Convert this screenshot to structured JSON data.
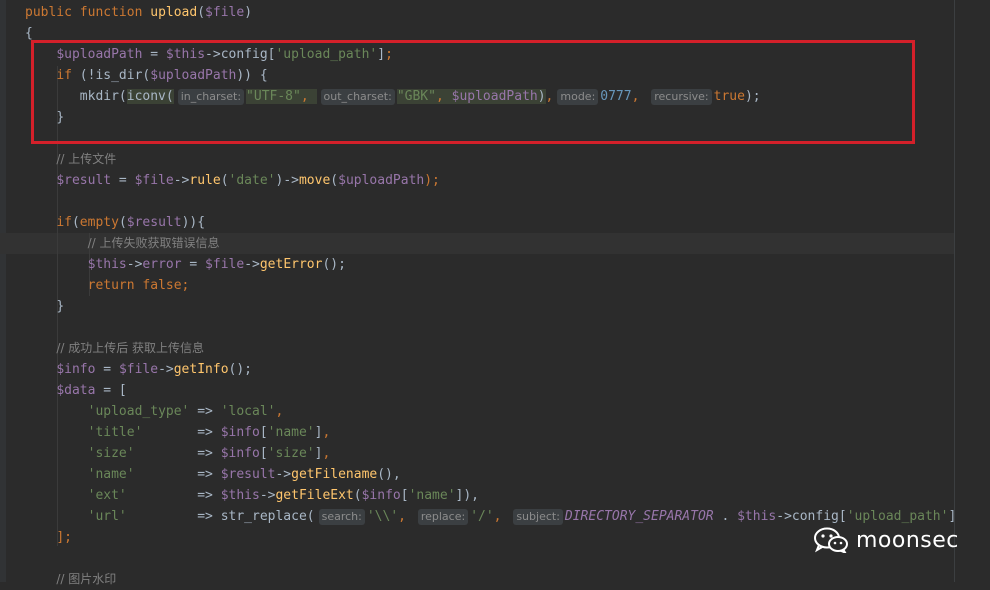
{
  "code_lines": [
    [
      {
        "t": "public ",
        "c": "kw"
      },
      {
        "t": "function ",
        "c": "kw"
      },
      {
        "t": "upload",
        "c": "fn"
      },
      {
        "t": "(",
        "c": "plain"
      },
      {
        "t": "$file",
        "c": "var"
      },
      {
        "t": ")",
        "c": "plain"
      }
    ],
    [
      {
        "t": "{",
        "c": "plain"
      }
    ],
    [
      {
        "t": "    "
      },
      {
        "t": "$uploadPath",
        "c": "var"
      },
      {
        "t": " = ",
        "c": "plain"
      },
      {
        "t": "$this",
        "c": "var"
      },
      {
        "t": "->",
        "c": "plain"
      },
      {
        "t": "config",
        "c": "plain"
      },
      {
        "t": "[",
        "c": "plain"
      },
      {
        "t": "'upload_path'",
        "c": "str"
      },
      {
        "t": "]",
        "c": "plain"
      },
      {
        "t": ";",
        "c": "kw"
      }
    ],
    [
      {
        "t": "    "
      },
      {
        "t": "if ",
        "c": "kw"
      },
      {
        "t": "(!",
        "c": "plain"
      },
      {
        "t": "is_dir",
        "c": "plain"
      },
      {
        "t": "(",
        "c": "plain"
      },
      {
        "t": "$uploadPath",
        "c": "var"
      },
      {
        "t": ")) {",
        "c": "plain"
      }
    ],
    [
      {
        "t": "       mkdir(",
        "c": "plain"
      },
      {
        "t": "iconv(",
        "c": "plain",
        "sel": true
      },
      {
        "h": "in_charset:"
      },
      {
        "t": "\"UTF-8\"",
        "c": "str",
        "sel": true
      },
      {
        "t": ", ",
        "c": "kw",
        "sel": true
      },
      {
        "h": "out_charset:"
      },
      {
        "t": "\"GBK\"",
        "c": "str",
        "sel": true
      },
      {
        "t": ", ",
        "c": "kw",
        "sel": true
      },
      {
        "t": "$uploadPath",
        "c": "var",
        "sel": true
      },
      {
        "t": ")",
        "c": "plain",
        "sel": true
      },
      {
        "t": ",",
        "c": "kw"
      },
      {
        "h": "mode:"
      },
      {
        "t": "0777",
        "c": "num"
      },
      {
        "t": ", ",
        "c": "kw"
      },
      {
        "h": "recursive:"
      },
      {
        "t": "true",
        "c": "kw"
      },
      {
        "t": ");",
        "c": "plain"
      }
    ],
    [
      {
        "t": "    "
      },
      {
        "t": "}",
        "c": "plain"
      }
    ],
    [],
    [
      {
        "t": "    "
      },
      {
        "t": "// 上传文件",
        "c": "cmt"
      }
    ],
    [
      {
        "t": "    "
      },
      {
        "t": "$result",
        "c": "var"
      },
      {
        "t": " = ",
        "c": "plain"
      },
      {
        "t": "$file",
        "c": "var"
      },
      {
        "t": "->",
        "c": "plain"
      },
      {
        "t": "rule",
        "c": "fn"
      },
      {
        "t": "(",
        "c": "plain"
      },
      {
        "t": "'date'",
        "c": "str"
      },
      {
        "t": ")->",
        "c": "plain"
      },
      {
        "t": "move",
        "c": "fn"
      },
      {
        "t": "(",
        "c": "plain"
      },
      {
        "t": "$uploadPath",
        "c": "var"
      },
      {
        "t": ");",
        "c": "kw"
      }
    ],
    [],
    [
      {
        "t": "    "
      },
      {
        "t": "if",
        "c": "kw"
      },
      {
        "t": "(",
        "c": "plain"
      },
      {
        "t": "empty",
        "c": "kw"
      },
      {
        "t": "(",
        "c": "plain"
      },
      {
        "t": "$result",
        "c": "var"
      },
      {
        "t": ")){",
        "c": "plain"
      }
    ],
    [
      {
        "t": "        "
      },
      {
        "t": "// 上传失败获取错误信息",
        "c": "cmt"
      }
    ],
    [
      {
        "t": "        "
      },
      {
        "t": "$this",
        "c": "var"
      },
      {
        "t": "->",
        "c": "plain"
      },
      {
        "t": "error",
        "c": "var"
      },
      {
        "t": " = ",
        "c": "plain"
      },
      {
        "t": "$file",
        "c": "var"
      },
      {
        "t": "->",
        "c": "plain"
      },
      {
        "t": "getError",
        "c": "fn"
      },
      {
        "t": "();",
        "c": "plain"
      }
    ],
    [
      {
        "t": "        "
      },
      {
        "t": "return false",
        "c": "kw"
      },
      {
        "t": ";",
        "c": "kw"
      }
    ],
    [
      {
        "t": "    "
      },
      {
        "t": "}",
        "c": "plain"
      }
    ],
    [],
    [
      {
        "t": "    "
      },
      {
        "t": "// 成功上传后 获取上传信息",
        "c": "cmt"
      }
    ],
    [
      {
        "t": "    "
      },
      {
        "t": "$info",
        "c": "var"
      },
      {
        "t": " = ",
        "c": "plain"
      },
      {
        "t": "$file",
        "c": "var"
      },
      {
        "t": "->",
        "c": "plain"
      },
      {
        "t": "getInfo",
        "c": "fn"
      },
      {
        "t": "();",
        "c": "plain"
      }
    ],
    [
      {
        "t": "    "
      },
      {
        "t": "$data",
        "c": "var"
      },
      {
        "t": " = [",
        "c": "plain"
      }
    ],
    [
      {
        "t": "        "
      },
      {
        "t": "'upload_type'",
        "c": "str"
      },
      {
        "t": " => ",
        "c": "plain"
      },
      {
        "t": "'local'",
        "c": "str"
      },
      {
        "t": ",",
        "c": "kw"
      }
    ],
    [
      {
        "t": "        "
      },
      {
        "t": "'title'",
        "c": "str"
      },
      {
        "t": "       => ",
        "c": "plain"
      },
      {
        "t": "$info",
        "c": "var"
      },
      {
        "t": "[",
        "c": "plain"
      },
      {
        "t": "'name'",
        "c": "str"
      },
      {
        "t": "]",
        "c": "plain"
      },
      {
        "t": ",",
        "c": "kw"
      }
    ],
    [
      {
        "t": "        "
      },
      {
        "t": "'size'",
        "c": "str"
      },
      {
        "t": "        => ",
        "c": "plain"
      },
      {
        "t": "$info",
        "c": "var"
      },
      {
        "t": "[",
        "c": "plain"
      },
      {
        "t": "'size'",
        "c": "str"
      },
      {
        "t": "]",
        "c": "plain"
      },
      {
        "t": ",",
        "c": "kw"
      }
    ],
    [
      {
        "t": "        "
      },
      {
        "t": "'name'",
        "c": "str"
      },
      {
        "t": "        => ",
        "c": "plain"
      },
      {
        "t": "$result",
        "c": "var"
      },
      {
        "t": "->",
        "c": "plain"
      },
      {
        "t": "getFilename",
        "c": "fn"
      },
      {
        "t": "(),",
        "c": "plain"
      }
    ],
    [
      {
        "t": "        "
      },
      {
        "t": "'ext'",
        "c": "str"
      },
      {
        "t": "         => ",
        "c": "plain"
      },
      {
        "t": "$this",
        "c": "var"
      },
      {
        "t": "->",
        "c": "plain"
      },
      {
        "t": "getFileExt",
        "c": "fn"
      },
      {
        "t": "(",
        "c": "plain"
      },
      {
        "t": "$info",
        "c": "var"
      },
      {
        "t": "[",
        "c": "plain"
      },
      {
        "t": "'name'",
        "c": "str"
      },
      {
        "t": "]),",
        "c": "plain"
      }
    ],
    [
      {
        "t": "        "
      },
      {
        "t": "'url'",
        "c": "str"
      },
      {
        "t": "         => ",
        "c": "plain"
      },
      {
        "t": "str_replace(",
        "c": "plain"
      },
      {
        "h": "search:"
      },
      {
        "t": "'\\\\'",
        "c": "str"
      },
      {
        "t": ", ",
        "c": "kw"
      },
      {
        "h": "replace:"
      },
      {
        "t": "'/'",
        "c": "str"
      },
      {
        "t": ", ",
        "c": "kw"
      },
      {
        "h": "subject:"
      },
      {
        "t": "DIRECTORY_SEPARATOR",
        "c": "const"
      },
      {
        "t": " . ",
        "c": "plain"
      },
      {
        "t": "$this",
        "c": "var"
      },
      {
        "t": "->",
        "c": "plain"
      },
      {
        "t": "config",
        "c": "plain"
      },
      {
        "t": "[",
        "c": "plain"
      },
      {
        "t": "'upload_path'",
        "c": "str"
      },
      {
        "t": "]",
        "c": "plain"
      }
    ],
    [
      {
        "t": "    "
      },
      {
        "t": "];",
        "c": "kw"
      }
    ],
    [],
    [
      {
        "t": "    "
      },
      {
        "t": "// 图片水印",
        "c": "cmt"
      }
    ]
  ],
  "watermark": {
    "text": "moonsec",
    "icon": "wechat-icon"
  },
  "colors": {
    "background": "#2b2b2b",
    "keyword": "#cc7832",
    "function": "#ffc66d",
    "variable": "#9876aa",
    "string": "#6a8759",
    "number": "#6897bb",
    "comment": "#808080",
    "annotation_box": "#d4202a"
  }
}
